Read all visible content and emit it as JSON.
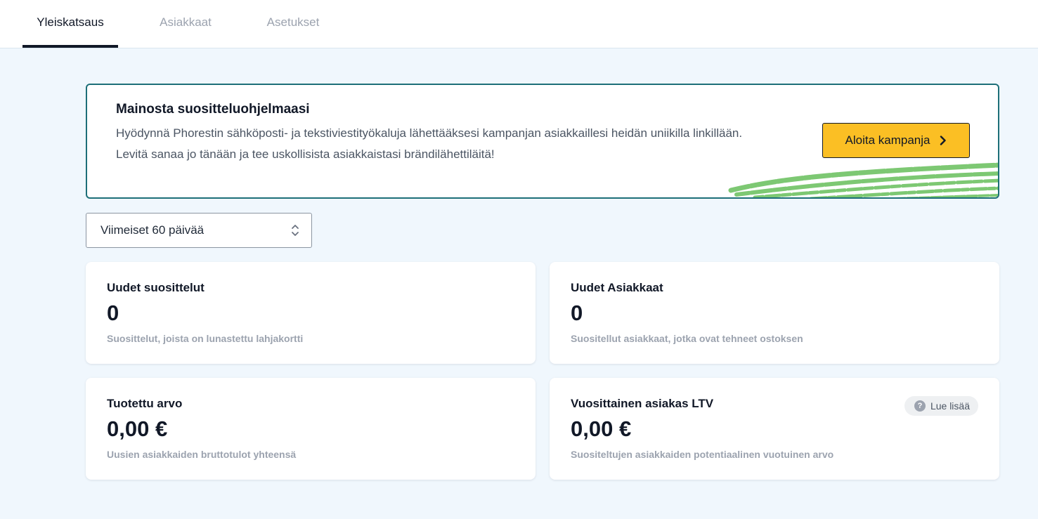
{
  "tabs": [
    {
      "label": "Yleiskatsaus",
      "active": true
    },
    {
      "label": "Asiakkaat",
      "active": false
    },
    {
      "label": "Asetukset",
      "active": false
    }
  ],
  "promo": {
    "title": "Mainosta suositteluohjelmaasi",
    "line1": "Hyödynnä Phorestin sähköposti- ja tekstiviestityökaluja lähettääksesi kampanjan asiakkaillesi heidän uniikilla linkillään.",
    "line2": "Levitä sanaa jo tänään ja tee uskollisista asiakkaistasi brändilähettiläitä!",
    "button_label": "Aloita kampanja",
    "button_icon": "chevron-right-icon",
    "accent_color": "#fbbf24",
    "border_color": "#1d6f78",
    "scribble_color": "#7dc873"
  },
  "date_range": {
    "selected": "Viimeiset 60 päivää",
    "icon": "up-down-chevron-icon"
  },
  "stats": [
    {
      "title": "Uudet suosittelut",
      "value": "0",
      "description": "Suosittelut, joista on lunastettu lahjakortti"
    },
    {
      "title": "Uudet Asiakkaat",
      "value": "0",
      "description": "Suositellut asiakkaat, jotka ovat tehneet ostoksen"
    },
    {
      "title": "Tuotettu arvo",
      "value": "0,00 €",
      "description": "Uusien asiakkaiden bruttotulot yhteensä"
    },
    {
      "title": "Vuosittainen asiakas LTV",
      "value": "0,00 €",
      "description": "Suositeltujen asiakkaiden potentiaalinen vuotuinen arvo",
      "help_label": "Lue lisää",
      "help_icon": "question-circle-icon"
    }
  ]
}
